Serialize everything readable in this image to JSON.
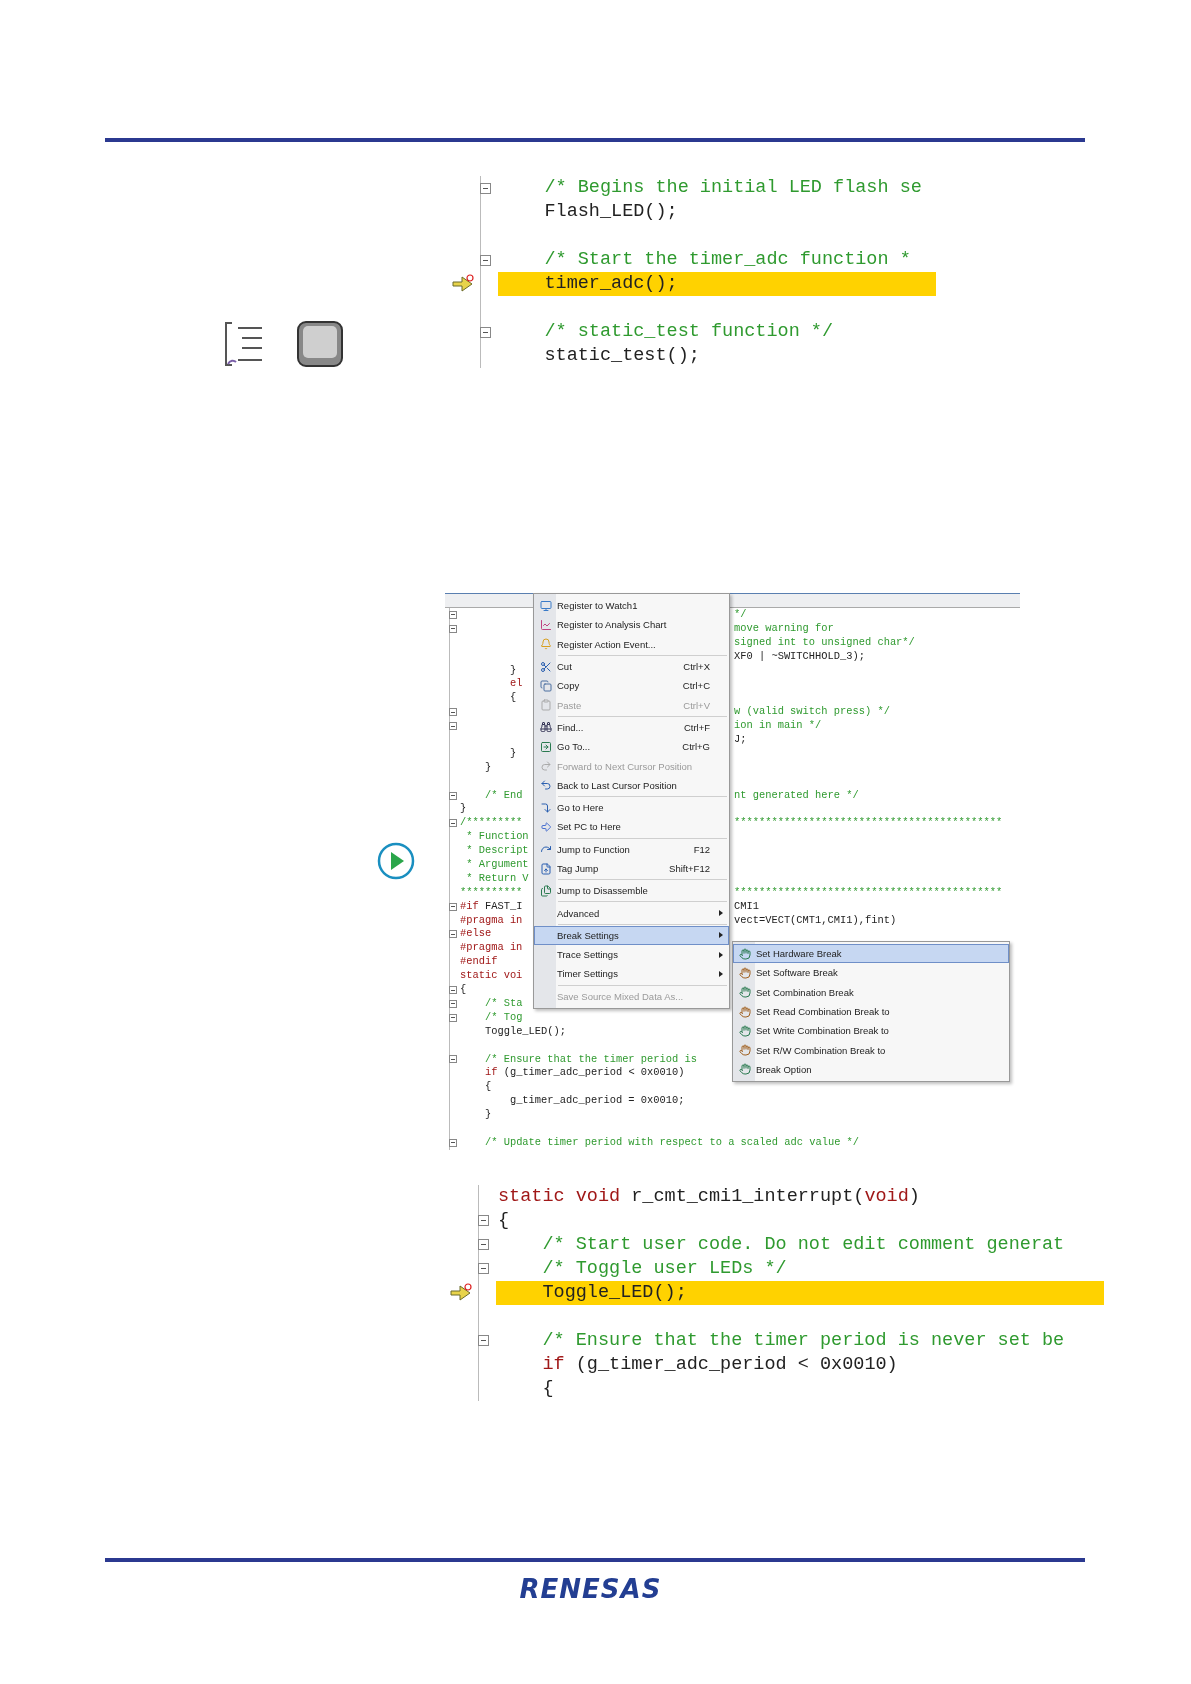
{
  "snippet_top": {
    "rows": [
      {
        "fold": true,
        "current": false,
        "tokens": [
          {
            "text": "    /* Begins the initial LED flash se",
            "kind": "comment"
          }
        ]
      },
      {
        "fold": false,
        "current": false,
        "tokens": [
          {
            "text": "    Flash_LED();",
            "kind": "code"
          }
        ]
      },
      {
        "fold": false,
        "current": false,
        "tokens": []
      },
      {
        "fold": true,
        "current": false,
        "tokens": [
          {
            "text": "    /* Start the timer_adc function *",
            "kind": "comment"
          }
        ]
      },
      {
        "fold": false,
        "current": true,
        "tokens": [
          {
            "text": "    timer_adc();",
            "kind": "code"
          }
        ]
      },
      {
        "fold": false,
        "current": false,
        "tokens": []
      },
      {
        "fold": true,
        "current": false,
        "tokens": [
          {
            "text": "    /* static_test function */",
            "kind": "comment"
          }
        ]
      },
      {
        "fold": false,
        "current": false,
        "tokens": [
          {
            "text": "    static_test();",
            "kind": "code"
          }
        ]
      }
    ]
  },
  "editor": {
    "rows": [
      {
        "kind": "split",
        "fold": true,
        "left": [],
        "right": [
          {
            "text": "*/",
            "kind": "comment"
          }
        ]
      },
      {
        "kind": "split",
        "fold": true,
        "left": [],
        "right": [
          {
            "text": "move warning for",
            "kind": "comment"
          }
        ]
      },
      {
        "kind": "split",
        "fold": false,
        "left": [],
        "right": [
          {
            "text": "signed int to unsigned char*/",
            "kind": "comment"
          }
        ]
      },
      {
        "kind": "split",
        "fold": false,
        "left": [],
        "right": [
          {
            "text": "XF0 | ~SWITCHHOLD_3);",
            "kind": "code"
          }
        ]
      },
      {
        "kind": "split",
        "fold": false,
        "left": [
          {
            "text": "        }",
            "kind": "code"
          }
        ],
        "right": []
      },
      {
        "kind": "split",
        "fold": false,
        "left": [
          {
            "text": "        el",
            "kind": "keyword"
          }
        ],
        "right": []
      },
      {
        "kind": "split",
        "fold": false,
        "left": [
          {
            "text": "        {",
            "kind": "code"
          }
        ],
        "right": []
      },
      {
        "kind": "split",
        "fold": true,
        "left": [],
        "right": [
          {
            "text": "w (valid switch press) */",
            "kind": "comment"
          }
        ]
      },
      {
        "kind": "split",
        "fold": true,
        "left": [],
        "right": [
          {
            "text": "ion in main */",
            "kind": "comment"
          }
        ]
      },
      {
        "kind": "split",
        "fold": false,
        "left": [],
        "right": [
          {
            "text": "J;",
            "kind": "code"
          }
        ]
      },
      {
        "kind": "split",
        "fold": false,
        "left": [
          {
            "text": "        }",
            "kind": "code"
          }
        ],
        "right": []
      },
      {
        "kind": "split",
        "fold": false,
        "left": [
          {
            "text": "    }",
            "kind": "code"
          }
        ],
        "right": []
      },
      {
        "kind": "split",
        "fold": false,
        "left": [],
        "right": []
      },
      {
        "kind": "split",
        "fold": true,
        "left": [
          {
            "text": "    /* End",
            "kind": "comment"
          }
        ],
        "right": [
          {
            "text": "nt generated here */",
            "kind": "comment"
          }
        ]
      },
      {
        "kind": "split",
        "fold": false,
        "left": [
          {
            "text": "}",
            "kind": "code"
          }
        ],
        "right": []
      },
      {
        "kind": "split",
        "fold": true,
        "left": [
          {
            "text": "/*********",
            "kind": "comment"
          }
        ],
        "right": [
          {
            "text": "*******************************************",
            "kind": "comment"
          }
        ]
      },
      {
        "kind": "split",
        "fold": false,
        "left": [
          {
            "text": " * Function",
            "kind": "comment"
          }
        ],
        "right": []
      },
      {
        "kind": "split",
        "fold": false,
        "left": [
          {
            "text": " * Descript",
            "kind": "comment"
          }
        ],
        "right": []
      },
      {
        "kind": "split",
        "fold": false,
        "left": [
          {
            "text": " * Argument",
            "kind": "comment"
          }
        ],
        "right": []
      },
      {
        "kind": "split",
        "fold": false,
        "left": [
          {
            "text": " * Return V",
            "kind": "comment"
          }
        ],
        "right": []
      },
      {
        "kind": "split",
        "fold": false,
        "left": [
          {
            "text": "**********",
            "kind": "comment"
          }
        ],
        "right": [
          {
            "text": "*******************************************",
            "kind": "comment"
          }
        ]
      },
      {
        "kind": "split",
        "fold": true,
        "left": [
          {
            "text": "#if",
            "kind": "keyword"
          },
          {
            "text": " FAST_I",
            "kind": "code"
          }
        ],
        "right": [
          {
            "text": "CMI1",
            "kind": "code"
          }
        ]
      },
      {
        "kind": "split",
        "fold": false,
        "left": [
          {
            "text": "#pragma in",
            "kind": "keyword"
          }
        ],
        "right": [
          {
            "text": "vect=VECT(CMT1,CMI1),fint)",
            "kind": "code"
          }
        ]
      },
      {
        "kind": "split",
        "fold": true,
        "left": [
          {
            "text": "#else",
            "kind": "keyword"
          }
        ],
        "right": []
      },
      {
        "kind": "split",
        "fold": false,
        "left": [
          {
            "text": "#pragma in",
            "kind": "keyword"
          }
        ],
        "right": []
      },
      {
        "kind": "split",
        "fold": false,
        "left": [
          {
            "text": "#endif",
            "kind": "keyword"
          }
        ],
        "right": []
      },
      {
        "kind": "split",
        "fold": false,
        "left": [
          {
            "text": "static voi",
            "kind": "keyword"
          }
        ],
        "right": []
      },
      {
        "kind": "split",
        "fold": true,
        "left": [
          {
            "text": "{",
            "kind": "code"
          }
        ],
        "right": []
      },
      {
        "kind": "split",
        "fold": true,
        "left": [
          {
            "text": "    /* Sta",
            "kind": "comment"
          }
        ],
        "right": []
      },
      {
        "kind": "split",
        "fold": true,
        "left": [
          {
            "text": "    /* Tog",
            "kind": "comment"
          }
        ],
        "right": []
      },
      {
        "kind": "full",
        "fold": false,
        "tokens": [
          {
            "text": "    Toggle_LED();",
            "kind": "code"
          }
        ]
      },
      {
        "kind": "full",
        "fold": false,
        "tokens": []
      },
      {
        "kind": "full",
        "fold": true,
        "tokens": [
          {
            "text": "    /* Ensure that the timer period is",
            "kind": "comment"
          }
        ]
      },
      {
        "kind": "full",
        "fold": false,
        "tokens": [
          {
            "text": "    if",
            "kind": "keyword"
          },
          {
            "text": " (g_timer_adc_period < 0x0010)",
            "kind": "code"
          }
        ]
      },
      {
        "kind": "full",
        "fold": false,
        "tokens": [
          {
            "text": "    {",
            "kind": "code"
          }
        ]
      },
      {
        "kind": "full",
        "fold": false,
        "tokens": [
          {
            "text": "        g_timer_adc_period = 0x0010;",
            "kind": "code"
          }
        ]
      },
      {
        "kind": "full",
        "fold": false,
        "tokens": [
          {
            "text": "    }",
            "kind": "code"
          }
        ]
      },
      {
        "kind": "full",
        "fold": false,
        "tokens": []
      },
      {
        "kind": "full",
        "fold": true,
        "tokens": [
          {
            "text": "    /* Update timer period with respect to a scaled adc value */",
            "kind": "comment"
          }
        ]
      }
    ],
    "menu": {
      "groups": [
        [
          {
            "label": "Register to Watch1",
            "disabled": false,
            "selected": false,
            "submenu": false
          },
          {
            "label": "Register to Analysis Chart",
            "disabled": false,
            "selected": false,
            "submenu": false
          },
          {
            "label": "Register Action Event...",
            "disabled": false,
            "selected": false,
            "submenu": false
          }
        ],
        [
          {
            "label": "Cut",
            "shortcut": "Ctrl+X",
            "disabled": false,
            "selected": false,
            "submenu": false
          },
          {
            "label": "Copy",
            "shortcut": "Ctrl+C",
            "disabled": false,
            "selected": false,
            "submenu": false
          },
          {
            "label": "Paste",
            "shortcut": "Ctrl+V",
            "disabled": true,
            "selected": false,
            "submenu": false
          }
        ],
        [
          {
            "label": "Find...",
            "shortcut": "Ctrl+F",
            "disabled": false,
            "selected": false,
            "submenu": false
          },
          {
            "label": "Go To...",
            "shortcut": "Ctrl+G",
            "disabled": false,
            "selected": false,
            "submenu": false
          },
          {
            "label": "Forward to Next Cursor Position",
            "disabled": true,
            "selected": false,
            "submenu": false
          },
          {
            "label": "Back to Last Cursor Position",
            "disabled": false,
            "selected": false,
            "submenu": false
          }
        ],
        [
          {
            "label": "Go to Here",
            "disabled": false,
            "selected": false,
            "submenu": false
          },
          {
            "label": "Set PC to Here",
            "disabled": false,
            "selected": false,
            "submenu": false
          }
        ],
        [
          {
            "label": "Jump to Function",
            "shortcut": "F12",
            "disabled": false,
            "selected": false,
            "submenu": false
          },
          {
            "label": "Tag Jump",
            "shortcut": "Shift+F12",
            "disabled": false,
            "selected": false,
            "submenu": false
          }
        ],
        [
          {
            "label": "Jump to Disassemble",
            "disabled": false,
            "selected": false,
            "submenu": false
          }
        ],
        [
          {
            "label": "Advanced",
            "disabled": false,
            "selected": false,
            "submenu": true
          }
        ],
        [
          {
            "label": "Break Settings",
            "disabled": false,
            "selected": true,
            "submenu": true
          },
          {
            "label": "Trace Settings",
            "disabled": false,
            "selected": false,
            "submenu": true
          },
          {
            "label": "Timer Settings",
            "disabled": false,
            "selected": false,
            "submenu": true
          }
        ],
        [
          {
            "label": "Save Source Mixed Data As...",
            "disabled": true,
            "selected": false,
            "submenu": false
          }
        ]
      ]
    },
    "submenu": {
      "items": [
        {
          "label": "Set Hardware Break",
          "selected": true
        },
        {
          "label": "Set Software Break",
          "selected": false
        },
        {
          "label": "Set Combination Break",
          "selected": false
        },
        {
          "label": "Set Read Combination Break to",
          "selected": false
        },
        {
          "label": "Set Write Combination Break to",
          "selected": false
        },
        {
          "label": "Set R/W Combination Break to",
          "selected": false
        },
        {
          "label": "Break Option",
          "selected": false
        }
      ]
    }
  },
  "snippet_bottom": {
    "rows": [
      {
        "fold": false,
        "current": false,
        "tokens": [
          {
            "text": "static void",
            "kind": "keyword"
          },
          {
            "text": " r_cmt_cmi1_interrupt(",
            "kind": "code"
          },
          {
            "text": "void",
            "kind": "keyword"
          },
          {
            "text": ")",
            "kind": "code"
          }
        ]
      },
      {
        "fold": true,
        "current": false,
        "tokens": [
          {
            "text": "{",
            "kind": "code"
          }
        ]
      },
      {
        "fold": true,
        "current": false,
        "tokens": [
          {
            "text": "    /* Start user code. Do not edit comment generat",
            "kind": "comment"
          }
        ]
      },
      {
        "fold": true,
        "current": false,
        "tokens": [
          {
            "text": "    /* Toggle user LEDs */",
            "kind": "comment"
          }
        ]
      },
      {
        "fold": false,
        "current": true,
        "tokens": [
          {
            "text": "    Toggle_LED();",
            "kind": "code"
          }
        ]
      },
      {
        "fold": false,
        "current": false,
        "tokens": []
      },
      {
        "fold": true,
        "current": false,
        "tokens": [
          {
            "text": "    /* Ensure that the timer period is never set be",
            "kind": "comment"
          }
        ]
      },
      {
        "fold": false,
        "current": false,
        "tokens": [
          {
            "text": "    if",
            "kind": "keyword"
          },
          {
            "text": " (g_timer_adc_period < 0x0010)",
            "kind": "code"
          }
        ]
      },
      {
        "fold": false,
        "current": false,
        "tokens": [
          {
            "text": "    {",
            "kind": "code"
          }
        ]
      }
    ]
  },
  "footer": {
    "logo": "RENESAS"
  }
}
